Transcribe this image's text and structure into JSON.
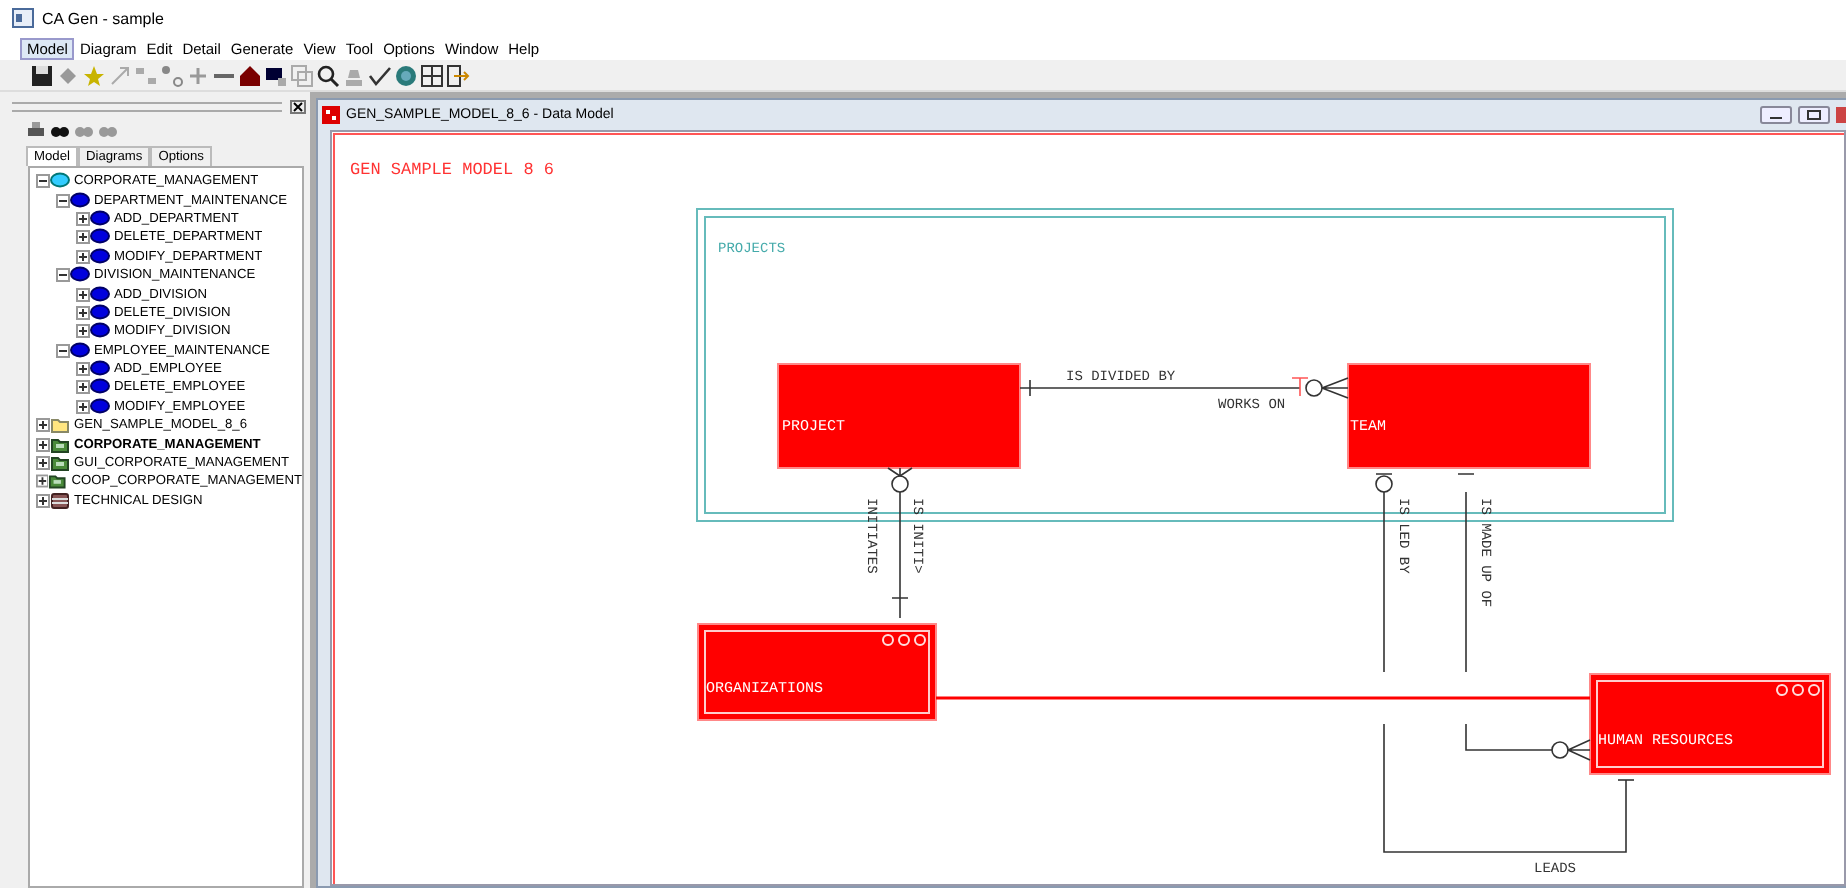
{
  "window": {
    "title": "CA Gen - sample"
  },
  "menu": [
    {
      "label": "Model",
      "selected": true
    },
    {
      "label": "Diagram",
      "selected": false
    },
    {
      "label": "Edit",
      "selected": false
    },
    {
      "label": "Detail",
      "selected": false
    },
    {
      "label": "Generate",
      "selected": false
    },
    {
      "label": "View",
      "selected": false
    },
    {
      "label": "Tool",
      "selected": false
    },
    {
      "label": "Options",
      "selected": false
    },
    {
      "label": "Window",
      "selected": false
    },
    {
      "label": "Help",
      "selected": false
    }
  ],
  "left_pane": {
    "tabs": [
      {
        "label": "Model",
        "selected": true
      },
      {
        "label": "Diagrams",
        "selected": false
      },
      {
        "label": "Options",
        "selected": false
      }
    ],
    "tree": [
      {
        "label": "CORPORATE_MANAGEMENT",
        "kind": "model",
        "bold": false,
        "expanded": true,
        "children": [
          {
            "label": "DEPARTMENT_MAINTENANCE",
            "kind": "process",
            "expanded": true,
            "children": [
              {
                "label": "ADD_DEPARTMENT",
                "kind": "process",
                "expanded": false
              },
              {
                "label": "DELETE_DEPARTMENT",
                "kind": "process",
                "expanded": false
              },
              {
                "label": "MODIFY_DEPARTMENT",
                "kind": "process",
                "expanded": false
              }
            ]
          },
          {
            "label": "DIVISION_MAINTENANCE",
            "kind": "process",
            "expanded": true,
            "children": [
              {
                "label": "ADD_DIVISION",
                "kind": "process",
                "expanded": false
              },
              {
                "label": "DELETE_DIVISION",
                "kind": "process",
                "expanded": false
              },
              {
                "label": "MODIFY_DIVISION",
                "kind": "process",
                "expanded": false
              }
            ]
          },
          {
            "label": "EMPLOYEE_MAINTENANCE",
            "kind": "process",
            "expanded": true,
            "children": [
              {
                "label": "ADD_EMPLOYEE",
                "kind": "process",
                "expanded": false
              },
              {
                "label": "DELETE_EMPLOYEE",
                "kind": "process",
                "expanded": false
              },
              {
                "label": "MODIFY_EMPLOYEE",
                "kind": "process",
                "expanded": false
              }
            ]
          }
        ]
      },
      {
        "label": "GEN_SAMPLE_MODEL_8_6",
        "kind": "folder",
        "bold": false,
        "expanded": false
      },
      {
        "label": "CORPORATE_MANAGEMENT",
        "kind": "package",
        "bold": true,
        "expanded": false
      },
      {
        "label": "GUI_CORPORATE_MANAGEMENT",
        "kind": "package",
        "bold": false,
        "expanded": false
      },
      {
        "label": "COOP_CORPORATE_MANAGEMENT",
        "kind": "package",
        "bold": false,
        "expanded": false
      },
      {
        "label": "TECHNICAL DESIGN",
        "kind": "database",
        "bold": false,
        "expanded": false
      }
    ]
  },
  "document": {
    "title": "GEN_SAMPLE_MODEL_8_6 - Data Model",
    "diagram": {
      "model_title": "GEN SAMPLE MODEL 8 6",
      "subject_area": "PROJECTS",
      "entities": [
        {
          "label": "PROJECT",
          "kind": "plain"
        },
        {
          "label": "TEAM",
          "kind": "plain"
        },
        {
          "label": "ORGANIZATIONS",
          "kind": "detailed"
        },
        {
          "label": "HUMAN RESOURCES",
          "kind": "detailed"
        }
      ],
      "relationship_labels": [
        "IS DIVIDED BY",
        "WORKS ON",
        "INITIATES",
        "IS INITI>",
        "IS LED BY",
        "IS MADE UP OF",
        "LEADS"
      ]
    }
  }
}
